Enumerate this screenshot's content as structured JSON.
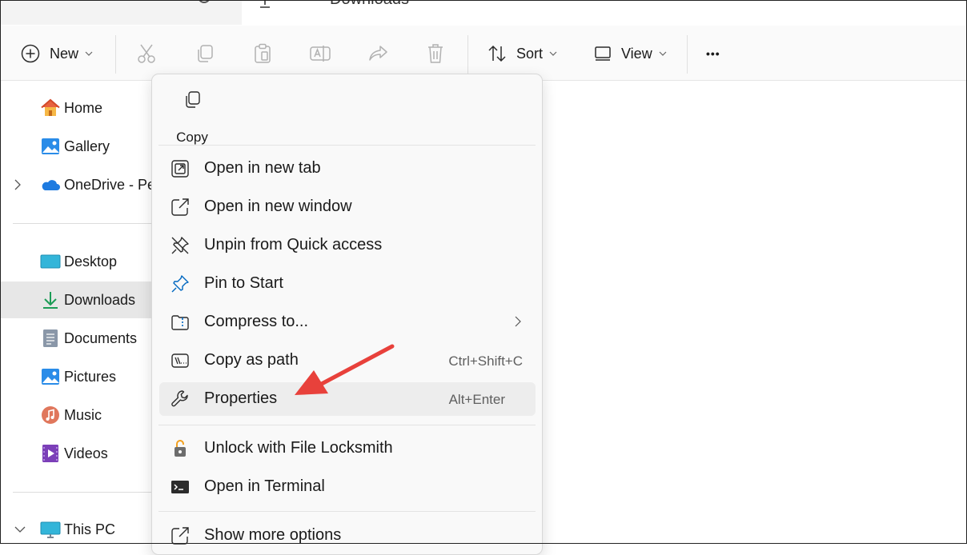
{
  "tab": {
    "title": "Downloads"
  },
  "toolbar": {
    "new_label": "New",
    "sort_label": "Sort",
    "view_label": "View",
    "more_label": "•••"
  },
  "sidebar": {
    "items": [
      {
        "label": "Home",
        "icon": "home-icon"
      },
      {
        "label": "Gallery",
        "icon": "gallery-icon"
      },
      {
        "label": "OneDrive - Pe",
        "icon": "onedrive-icon"
      },
      {
        "label": "Desktop",
        "icon": "desktop-icon"
      },
      {
        "label": "Downloads",
        "icon": "downloads-icon",
        "selected": true
      },
      {
        "label": "Documents",
        "icon": "documents-icon"
      },
      {
        "label": "Pictures",
        "icon": "pictures-icon"
      },
      {
        "label": "Music",
        "icon": "music-icon"
      },
      {
        "label": "Videos",
        "icon": "videos-icon"
      },
      {
        "label": "This PC",
        "icon": "this-pc-icon"
      }
    ]
  },
  "context_menu": {
    "quick_copy_label": "Copy",
    "items": [
      {
        "label": "Open in new tab",
        "icon": "open-new-tab-icon"
      },
      {
        "label": "Open in new window",
        "icon": "open-new-window-icon"
      },
      {
        "label": "Unpin from Quick access",
        "icon": "unpin-icon"
      },
      {
        "label": "Pin to Start",
        "icon": "pin-icon"
      },
      {
        "label": "Compress to...",
        "icon": "compress-folder-icon"
      },
      {
        "label": "Copy as path",
        "icon": "copy-path-icon",
        "shortcut": "Ctrl+Shift+C"
      },
      {
        "label": "Properties",
        "icon": "wrench-icon",
        "shortcut": "Alt+Enter",
        "highlighted": true
      },
      {
        "label": "Unlock with File Locksmith",
        "icon": "lock-icon"
      },
      {
        "label": "Open in Terminal",
        "icon": "terminal-icon"
      },
      {
        "label": "Show more options",
        "icon": "show-more-options-icon"
      }
    ]
  },
  "colors": {
    "accent": "#0067c0",
    "annotation_arrow": "#e8413b",
    "selected_bg": "#e7e7e7"
  }
}
